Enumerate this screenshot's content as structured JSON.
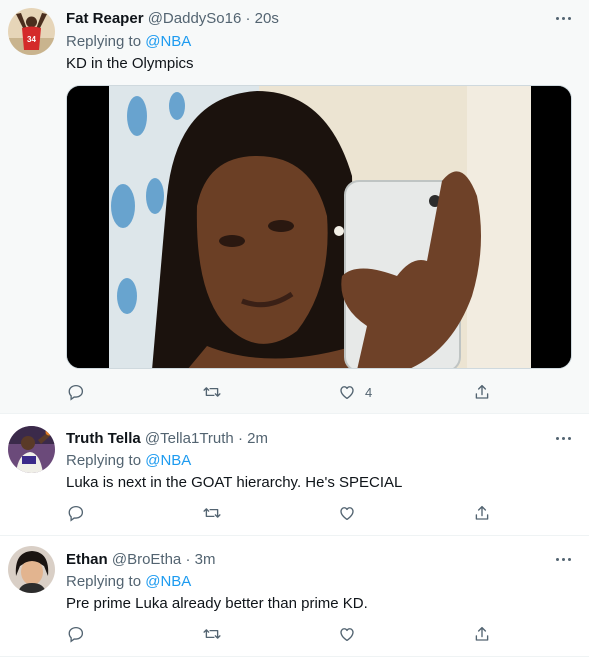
{
  "tweets": [
    {
      "name": "Fat Reaper",
      "handle": "@DaddySo16",
      "separator": "·",
      "time": "20s",
      "replying_prefix": "Replying to ",
      "replying_to": "@NBA",
      "text": "KD in the Olympics",
      "like_count": "4",
      "avatar_jersey_number": "34"
    },
    {
      "name": "Truth Tella",
      "handle": "@Tella1Truth",
      "separator": "·",
      "time": "2m",
      "replying_prefix": "Replying to ",
      "replying_to": "@NBA",
      "text": "Luka is next in the GOAT hierarchy. He's SPECIAL"
    },
    {
      "name": "Ethan",
      "handle": "@BroEtha",
      "separator": "·",
      "time": "3m",
      "replying_prefix": "Replying to ",
      "replying_to": "@NBA",
      "text": "Pre prime Luka already better than prime KD."
    }
  ],
  "colors": {
    "link": "#1d9bf0",
    "secondary_text": "#536471",
    "primary_text": "#0f1419",
    "highlight_background": "#f7f9f9"
  },
  "icons": {
    "reply": "reply-icon",
    "retweet": "retweet-icon",
    "like": "like-icon",
    "share": "share-icon",
    "more": "more-icon"
  }
}
